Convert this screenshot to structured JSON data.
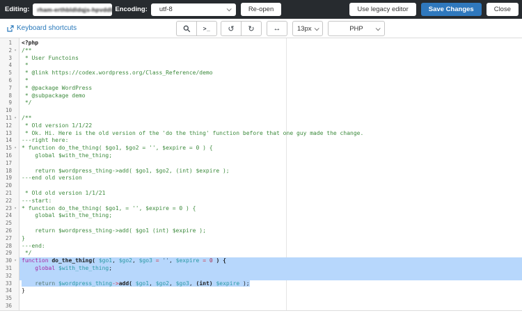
{
  "topbar": {
    "editing_label": "Editing:",
    "file_path": "rham-erthbldldqjs-hpvddla_b",
    "encoding_label": "Encoding:",
    "encoding_value": "utf-8",
    "reopen": "Re-open",
    "use_legacy": "Use legacy editor",
    "save": "Save Changes",
    "close": "Close"
  },
  "toolbar": {
    "keyboard_shortcuts": "Keyboard shortcuts",
    "terminal": ">_",
    "undo": "↺",
    "redo": "↻",
    "width_toggle": "↔",
    "font_size": "13px",
    "language": "PHP"
  },
  "colors": {
    "topbar_bg": "#272b2f",
    "save_button_blue": "#2f78bd",
    "link_blue": "#2878ba",
    "selection_blue": "#b7d7fc",
    "comment_green": "#3c8a3c",
    "keyword_purple": "#a626a4",
    "variable_teal": "#2b9aa5"
  },
  "editor": {
    "lines": [
      {
        "n": 1,
        "fold": false,
        "sel": "none",
        "parts": [
          [
            "m",
            "<?php"
          ]
        ]
      },
      {
        "n": 2,
        "fold": true,
        "sel": "none",
        "parts": [
          [
            "c",
            "/**"
          ]
        ]
      },
      {
        "n": 3,
        "fold": false,
        "sel": "none",
        "parts": [
          [
            "c",
            " * User Functoins"
          ]
        ]
      },
      {
        "n": 4,
        "fold": false,
        "sel": "none",
        "parts": [
          [
            "c",
            " *"
          ]
        ]
      },
      {
        "n": 5,
        "fold": false,
        "sel": "none",
        "parts": [
          [
            "c",
            " * @link https://codex.wordpress.org/Class_Reference/demo"
          ]
        ]
      },
      {
        "n": 6,
        "fold": false,
        "sel": "none",
        "parts": [
          [
            "c",
            " *"
          ]
        ]
      },
      {
        "n": 7,
        "fold": false,
        "sel": "none",
        "parts": [
          [
            "c",
            " * @package WordPress"
          ]
        ]
      },
      {
        "n": 8,
        "fold": false,
        "sel": "none",
        "parts": [
          [
            "c",
            " * @subpackage demo"
          ]
        ]
      },
      {
        "n": 9,
        "fold": false,
        "sel": "none",
        "parts": [
          [
            "c",
            " */"
          ]
        ]
      },
      {
        "n": 10,
        "fold": false,
        "sel": "none",
        "parts": []
      },
      {
        "n": 11,
        "fold": true,
        "sel": "none",
        "parts": [
          [
            "c",
            "/**"
          ]
        ]
      },
      {
        "n": 12,
        "fold": false,
        "sel": "none",
        "parts": [
          [
            "c",
            " * Old version 1/1/22"
          ]
        ]
      },
      {
        "n": 13,
        "fold": false,
        "sel": "none",
        "parts": [
          [
            "c",
            " * Ok. Hi. Here is the old version of the 'do the thing' function before that one guy made the change."
          ]
        ]
      },
      {
        "n": 14,
        "fold": false,
        "sel": "none",
        "parts": [
          [
            "c",
            "---right here:"
          ]
        ]
      },
      {
        "n": 15,
        "fold": true,
        "sel": "none",
        "parts": [
          [
            "c",
            "* function do_the_thing( $go1, $go2 = '', $expire = 0 ) {"
          ]
        ]
      },
      {
        "n": 16,
        "fold": false,
        "sel": "none",
        "parts": [
          [
            "c",
            "    global $with_the_thing;"
          ]
        ]
      },
      {
        "n": 17,
        "fold": false,
        "sel": "none",
        "parts": []
      },
      {
        "n": 18,
        "fold": false,
        "sel": "none",
        "parts": [
          [
            "c",
            "    return $wordpress_thing->add( $go1, $go2, (int) $expire );"
          ]
        ]
      },
      {
        "n": 19,
        "fold": false,
        "sel": "none",
        "parts": [
          [
            "c",
            "---end old version"
          ]
        ]
      },
      {
        "n": 20,
        "fold": false,
        "sel": "none",
        "parts": []
      },
      {
        "n": 21,
        "fold": false,
        "sel": "none",
        "parts": [
          [
            "c",
            " * Old old version 1/1/21"
          ]
        ]
      },
      {
        "n": 22,
        "fold": false,
        "sel": "none",
        "parts": [
          [
            "c",
            "---start:"
          ]
        ]
      },
      {
        "n": 23,
        "fold": true,
        "sel": "none",
        "parts": [
          [
            "c",
            "* function do_the_thing( $go1, = '', $expire = 0 ) {"
          ]
        ]
      },
      {
        "n": 24,
        "fold": false,
        "sel": "none",
        "parts": [
          [
            "c",
            "    global $with_the_thing;"
          ]
        ]
      },
      {
        "n": 25,
        "fold": false,
        "sel": "none",
        "parts": []
      },
      {
        "n": 26,
        "fold": false,
        "sel": "none",
        "parts": [
          [
            "c",
            "    return $wordpress_thing->add( $go1 (int) $expire );"
          ]
        ]
      },
      {
        "n": 27,
        "fold": false,
        "sel": "none",
        "parts": [
          [
            "c",
            "}"
          ]
        ]
      },
      {
        "n": 28,
        "fold": false,
        "sel": "none",
        "parts": [
          [
            "c",
            "---end:"
          ]
        ]
      },
      {
        "n": 29,
        "fold": false,
        "sel": "none",
        "parts": [
          [
            "c",
            " */"
          ]
        ]
      },
      {
        "n": 30,
        "fold": true,
        "sel": "full",
        "parts": [
          [
            "k",
            "function"
          ],
          [
            "p",
            " "
          ],
          [
            "b",
            "do_the_thing("
          ],
          [
            "p",
            " "
          ],
          [
            "v",
            "$go1"
          ],
          [
            "p",
            ", "
          ],
          [
            "v",
            "$go2"
          ],
          [
            "p",
            ", "
          ],
          [
            "v",
            "$go3"
          ],
          [
            "p",
            " "
          ],
          [
            "o",
            "="
          ],
          [
            "p",
            " "
          ],
          [
            "s",
            "''"
          ],
          [
            "p",
            ", "
          ],
          [
            "v",
            "$expire"
          ],
          [
            "p",
            " "
          ],
          [
            "o",
            "="
          ],
          [
            "p",
            " "
          ],
          [
            "num",
            "0"
          ],
          [
            "p",
            " "
          ],
          [
            "b",
            ") {"
          ]
        ]
      },
      {
        "n": 31,
        "fold": false,
        "sel": "full",
        "parts": [
          [
            "p",
            "    "
          ],
          [
            "k",
            "global"
          ],
          [
            "p",
            " "
          ],
          [
            "v",
            "$with_the_thing"
          ],
          [
            "p",
            ";"
          ]
        ]
      },
      {
        "n": 32,
        "fold": false,
        "sel": "full",
        "parts": []
      },
      {
        "n": 33,
        "fold": false,
        "sel": "text",
        "parts": [
          [
            "p",
            "    "
          ],
          [
            "r",
            "return"
          ],
          [
            "p",
            " "
          ],
          [
            "v",
            "$wordpress_thing"
          ],
          [
            "o",
            "->"
          ],
          [
            "b",
            "add("
          ],
          [
            "p",
            " "
          ],
          [
            "v",
            "$go1"
          ],
          [
            "p",
            ", "
          ],
          [
            "v",
            "$go2"
          ],
          [
            "p",
            ", "
          ],
          [
            "v",
            "$go3"
          ],
          [
            "p",
            ", "
          ],
          [
            "b",
            "(int)"
          ],
          [
            "p",
            " "
          ],
          [
            "v",
            "$expire"
          ],
          [
            "p",
            " );"
          ]
        ]
      },
      {
        "n": 34,
        "fold": false,
        "sel": "none",
        "parts": [
          [
            "p",
            "}"
          ]
        ]
      },
      {
        "n": 35,
        "fold": false,
        "sel": "none",
        "parts": []
      },
      {
        "n": 36,
        "fold": false,
        "sel": "none",
        "parts": []
      }
    ]
  }
}
